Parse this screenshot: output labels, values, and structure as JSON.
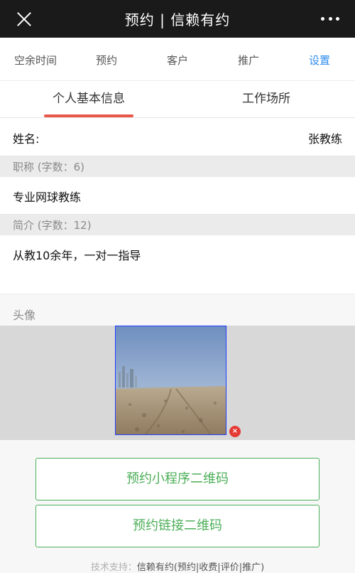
{
  "window": {
    "title": "预约 | 信赖有约"
  },
  "topnav": {
    "items": [
      {
        "label": "空余时间"
      },
      {
        "label": "预约"
      },
      {
        "label": "客户"
      },
      {
        "label": "推广"
      },
      {
        "label": "设置"
      }
    ],
    "active_index": 4,
    "active_color": "#2d8cf0"
  },
  "subtabs": {
    "items": [
      {
        "label": "个人基本信息"
      },
      {
        "label": "工作场所"
      }
    ],
    "active_index": 0,
    "indicator_color": "#e8574a"
  },
  "profile": {
    "name_label": "姓名:",
    "name_value": "张教练",
    "title_header": "职称 (字数：6)",
    "title_value": "专业网球教练",
    "intro_header": "简介 (字数：12)",
    "intro_value": "从教10余年，一对一指导",
    "avatar_header": "头像"
  },
  "avatar": {
    "description_icon": "beach-photo",
    "delete_icon": "×"
  },
  "actions": {
    "miniprogram_qr_label": "预约小程序二维码",
    "link_qr_label": "预约链接二维码",
    "accent_color": "#4cae58"
  },
  "footer": {
    "prefix": "技术支持：",
    "text": "信赖有约(预约|收费|评价|推广)"
  }
}
